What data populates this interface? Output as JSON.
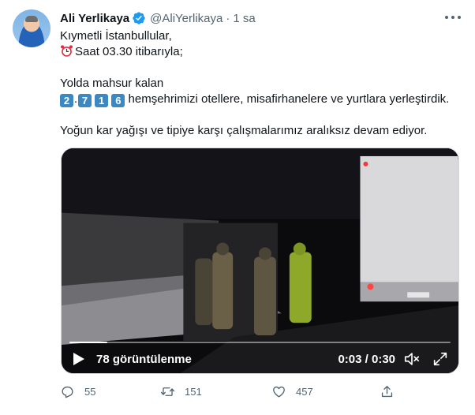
{
  "author": {
    "name": "Ali Yerlikaya",
    "handle": "@AliYerlikaya",
    "separator": "·",
    "time": "1 sa",
    "avatar_icon": "avatar",
    "verified_icon": "verified-badge-icon",
    "verified_color": "#1d9bf0"
  },
  "tweet": {
    "line1": "Kıymetli İstanbullular,",
    "line2_text": "Saat 03.30 itibarıyla;",
    "line2_icon": "alarm-clock-icon",
    "line3": "Yolda mahsur kalan",
    "line4_digits": [
      "2",
      "7",
      "1",
      "6"
    ],
    "line4_separator": ".",
    "line4_text": "hemşehrimizi otellere, misafirhanelere ve yurtlara yerleştirdik.",
    "line5": "Yoğun kar yağışı ve tipiye karşı çalışmalarımız aralıksız devam ediyor."
  },
  "video": {
    "views_label": "78 görüntülenme",
    "timecode": "0:03 / 0:30",
    "progress": 0.1
  },
  "actions": {
    "reply_count": "55",
    "retweet_count": "151",
    "like_count": "457"
  },
  "colors": {
    "text": "#0f1419",
    "muted": "#536471",
    "accent": "#1d9bf0",
    "keycap": "#3b88c3"
  }
}
